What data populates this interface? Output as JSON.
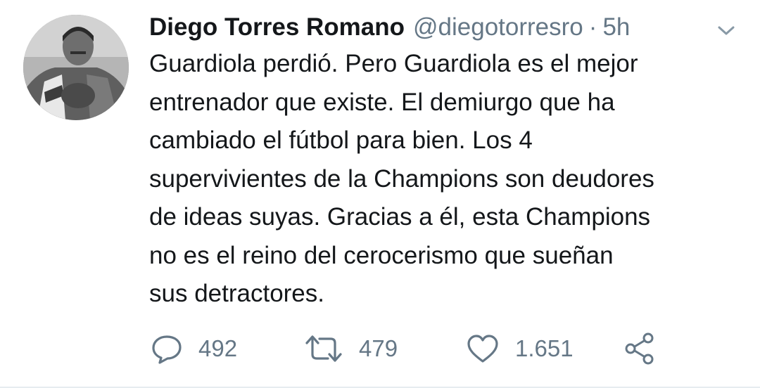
{
  "tweet": {
    "author_name": "Diego Torres Romano",
    "handle": "@diegotorresro",
    "separator": "·",
    "time": "5h",
    "text_lines": [
      "Guardiola perdió. Pero Guardiola es el mejor",
      "entrenador que existe. El demiurgo que ha",
      "cambiado el fútbol para bien. Los 4",
      "supervivientes de la Champions son deudores",
      "de ideas suyas. Gracias a él, esta Champions",
      "no es el reino del cerocerismo que sueñan",
      "sus detractores."
    ]
  },
  "actions": {
    "reply_count": "492",
    "retweet_count": "479",
    "like_count": "1.651"
  },
  "icons": {
    "caret": "chevron-down-icon",
    "reply": "reply-icon",
    "retweet": "retweet-icon",
    "like": "heart-icon",
    "share": "share-icon"
  },
  "colors": {
    "text": "#14171a",
    "secondary": "#657786",
    "divider": "#e6ecf0"
  }
}
